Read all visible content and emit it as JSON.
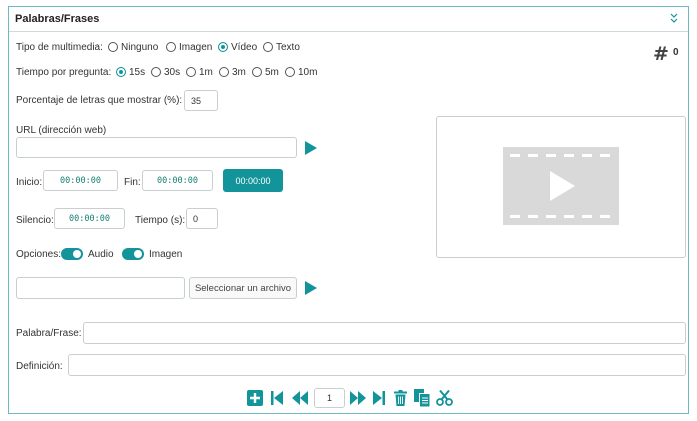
{
  "panel": {
    "title": "Palabras/Frases"
  },
  "counter": {
    "symbol": "#",
    "value": "0"
  },
  "media_type": {
    "label": "Tipo de multimedia:",
    "options": [
      "Ninguno",
      "Imagen",
      "Vídeo",
      "Texto"
    ],
    "selected": "Vídeo"
  },
  "time_per_question": {
    "label": "Tiempo por pregunta:",
    "options": [
      "15s",
      "30s",
      "1m",
      "3m",
      "5m",
      "10m"
    ],
    "selected": "15s"
  },
  "letters_percent": {
    "label": "Porcentaje de letras que mostrar (%):",
    "value": "35"
  },
  "url": {
    "label": "URL (dirección web)",
    "value": ""
  },
  "start": {
    "label": "Inicio:",
    "value": "00:00:00"
  },
  "end": {
    "label": "Fin:",
    "value": "00:00:00"
  },
  "current_time_button": "00:00:00",
  "silence": {
    "label": "Silencio:",
    "value": "00:00:00"
  },
  "time_seconds": {
    "label": "Tiempo (s):",
    "value": "0"
  },
  "options_row": {
    "label": "Opciones:",
    "audio_label": "Audio",
    "image_label": "Imagen",
    "audio_on": true,
    "image_on": true
  },
  "file": {
    "value": "",
    "select_label": "Seleccionar un archivo"
  },
  "word": {
    "label": "Palabra/Frase:",
    "value": ""
  },
  "definition": {
    "label": "Definición:",
    "value": ""
  },
  "pager": {
    "page": "1"
  },
  "colors": {
    "accent": "#13949a",
    "icon_gray": "#d9d9d9",
    "border": "#c9ced3"
  }
}
